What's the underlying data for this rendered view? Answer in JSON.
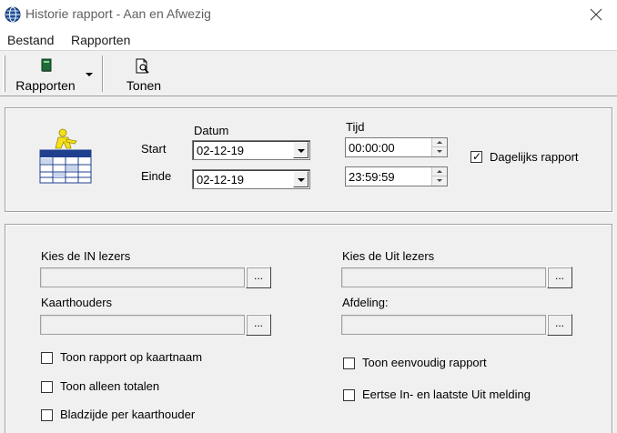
{
  "window": {
    "title": "Historie rapport - Aan en Afwezig"
  },
  "menu": {
    "items": [
      "Bestand",
      "Rapporten"
    ]
  },
  "toolbar": {
    "rapporten_label": "Rapporten",
    "tonen_label": "Tonen"
  },
  "period": {
    "datum_header": "Datum",
    "tijd_header": "Tijd",
    "start_label": "Start",
    "einde_label": "Einde",
    "start_date": "02-12-19",
    "end_date": "02-12-19",
    "start_time": "00:00:00",
    "end_time": "23:59:59",
    "daily_label": "Dagelijks rapport",
    "daily_checked": true
  },
  "filters": {
    "in_readers_label": "Kies de IN lezers",
    "out_readers_label": "Kies de Uit lezers",
    "cardholders_label": "Kaarthouders",
    "department_label": "Afdeling:",
    "browse_label": "...",
    "options": {
      "report_by_card_name": "Toon rapport op kaartnaam",
      "only_totals": "Toon alleen totalen",
      "page_per_cardholder": "Bladzijde per kaarthouder",
      "simple_report": "Toon eenvoudig rapport",
      "first_in_last_out": "Eertse In- en laatste Uit melding"
    }
  },
  "icons": {
    "app": "globe-icon",
    "rapporten": "book-icon",
    "tonen": "preview-document-icon",
    "report": "person-table-icon"
  },
  "colors": {
    "window_bg": "#f0f0f0",
    "titlebar_bg": "#ffffff",
    "icon_yellow": "#f5e11a",
    "icon_blue": "#1f3f8f"
  }
}
